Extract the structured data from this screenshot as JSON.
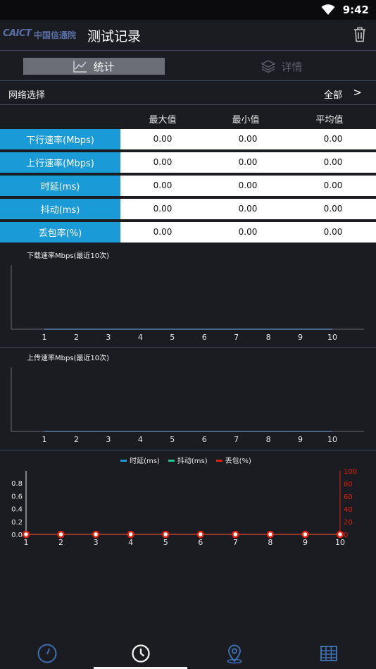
{
  "status": {
    "time": "9:42"
  },
  "appbar": {
    "logo_text": "CAICT",
    "logo_org": "中国信通院",
    "title": "测试记录"
  },
  "tabs": [
    {
      "label": "统计",
      "active": true
    },
    {
      "label": "详情",
      "active": false
    }
  ],
  "network": {
    "label": "网络选择",
    "value": "全部",
    "chevron": ">"
  },
  "stats": {
    "headers": [
      "最大值",
      "最小值",
      "平均值"
    ],
    "rows": [
      {
        "name": "下行速率(Mbps)",
        "max": "0.00",
        "min": "0.00",
        "avg": "0.00"
      },
      {
        "name": "上行速率(Mbps)",
        "max": "0.00",
        "min": "0.00",
        "avg": "0.00"
      },
      {
        "name": "时延(ms)",
        "max": "0.00",
        "min": "0.00",
        "avg": "0.00"
      },
      {
        "name": "抖动(ms)",
        "max": "0.00",
        "min": "0.00",
        "avg": "0.00"
      },
      {
        "name": "丢包率(%)",
        "max": "0.00",
        "min": "0.00",
        "avg": "0.00"
      }
    ]
  },
  "chart_data": [
    {
      "type": "line",
      "title": "下载速率Mbps(最近10次)",
      "categories": [
        "1",
        "2",
        "3",
        "4",
        "5",
        "6",
        "7",
        "8",
        "9",
        "10"
      ],
      "series": [
        {
          "values": [
            0,
            0,
            0,
            0,
            0,
            0,
            0,
            0,
            0,
            0
          ]
        }
      ]
    },
    {
      "type": "line",
      "title": "上传速率Mbps(最近10次)",
      "categories": [
        "1",
        "2",
        "3",
        "4",
        "5",
        "6",
        "7",
        "8",
        "9",
        "10"
      ],
      "series": [
        {
          "values": [
            0,
            0,
            0,
            0,
            0,
            0,
            0,
            0,
            0,
            0
          ]
        }
      ]
    },
    {
      "type": "line",
      "title": "",
      "categories": [
        "1",
        "2",
        "3",
        "4",
        "5",
        "6",
        "7",
        "8",
        "9",
        "10"
      ],
      "left_ticks": [
        "0.0",
        "0.2",
        "0.4",
        "0.6",
        "0.8"
      ],
      "right_ticks": [
        "0",
        "20",
        "40",
        "60",
        "80",
        "100"
      ],
      "legend_position": "top-center",
      "series": [
        {
          "name": "时延(ms)",
          "color": "#1b9ad8",
          "values": [
            0,
            0,
            0,
            0,
            0,
            0,
            0,
            0,
            0,
            0
          ]
        },
        {
          "name": "抖动(ms)",
          "color": "#1ec98f",
          "values": [
            0,
            0,
            0,
            0,
            0,
            0,
            0,
            0,
            0,
            0
          ]
        },
        {
          "name": "丢包(%)",
          "color": "#e0200f",
          "values": [
            0,
            0,
            0,
            0,
            0,
            0,
            0,
            0,
            0,
            0
          ]
        }
      ]
    }
  ],
  "bottom_nav": [
    {
      "icon": "speedometer-icon",
      "active": false
    },
    {
      "icon": "clock-icon",
      "active": true
    },
    {
      "icon": "location-pin-icon",
      "active": false
    },
    {
      "icon": "table-grid-icon",
      "active": false
    }
  ],
  "colors": {
    "accent": "#1b9ad8",
    "background": "#1b1c21",
    "red": "#e0200f"
  }
}
